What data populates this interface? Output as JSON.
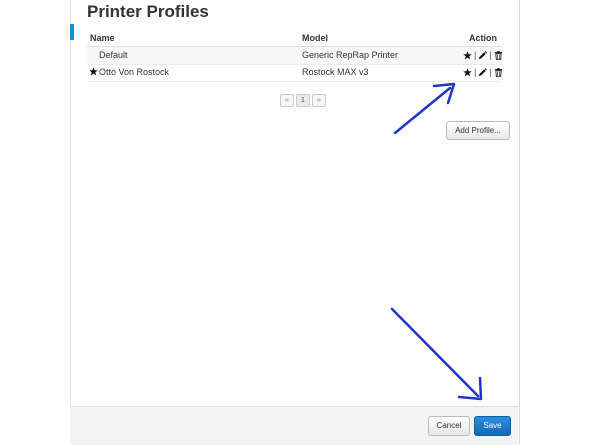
{
  "header": {
    "title": "Printer Profiles"
  },
  "table": {
    "columns": [
      "Name",
      "Model",
      "Action"
    ],
    "rows": [
      {
        "name": "Default",
        "model": "Generic RepRap Printer",
        "starred": false
      },
      {
        "name": "Otto Von Rostock",
        "model": "Rostock MAX v3",
        "starred": true
      }
    ],
    "action_icons": [
      "star-icon",
      "pencil-icon",
      "trash-icon"
    ],
    "separator": "|"
  },
  "pagination": {
    "prev": "«",
    "current": "1",
    "next": "»"
  },
  "buttons": {
    "add_profile": "Add Profile...",
    "cancel": "Cancel",
    "save": "Save"
  },
  "colors": {
    "accent": "#1a8fd1",
    "save_button": "#1a73c8",
    "annotation_arrow": "#2233cc"
  }
}
